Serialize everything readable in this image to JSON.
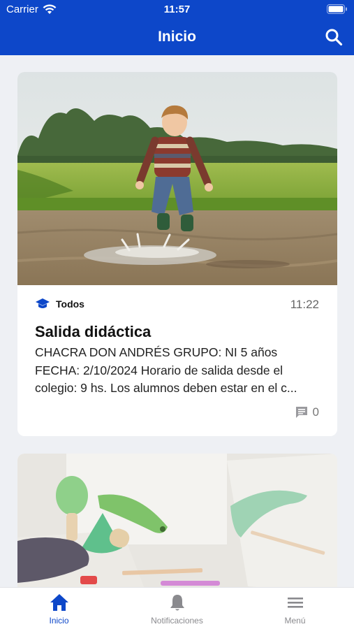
{
  "status": {
    "carrier": "Carrier",
    "time": "11:57"
  },
  "header": {
    "title": "Inicio"
  },
  "posts": [
    {
      "audience": "Todos",
      "time": "11:22",
      "title": "Salida didáctica",
      "body": "CHACRA DON ANDRÉS GRUPO: NI 5 años FECHA: 2/10/2024 Horario de salida desde el colegio: 9 hs. Los alumnos deben estar en el c...",
      "comment_count": "0"
    }
  ],
  "tabs": [
    {
      "label": "Inicio",
      "icon": "home-icon"
    },
    {
      "label": "Notificaciones",
      "icon": "bell-icon"
    },
    {
      "label": "Menú",
      "icon": "menu-icon"
    }
  ],
  "colors": {
    "brand": "#0d47c9",
    "background": "#eef0f4",
    "inactive_tab": "#8a8a8e"
  }
}
